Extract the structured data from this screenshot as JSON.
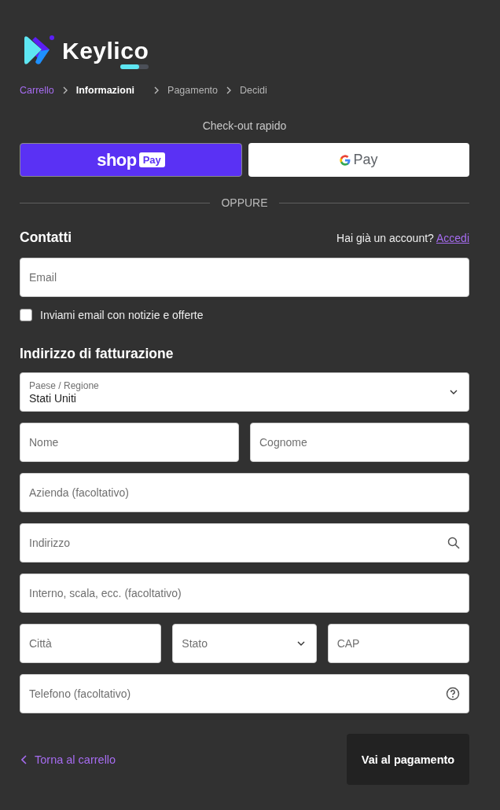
{
  "brand": {
    "name": "Keylico"
  },
  "breadcrumb": [
    {
      "label": "Carrello",
      "done": true,
      "selected": false
    },
    {
      "label": "Informazioni",
      "done": false,
      "selected": true
    },
    {
      "label": "Pagamento",
      "done": false,
      "selected": false
    },
    {
      "label": "Decidi",
      "done": false,
      "selected": false
    }
  ],
  "express": {
    "title": "Check-out rapido",
    "shop_pay": {
      "word": "shop",
      "badge": "Pay"
    },
    "google_pay": {
      "word": "Pay"
    }
  },
  "divider": "OPPURE",
  "contact": {
    "heading": "Contatti",
    "account_prompt": "Hai già un account?",
    "login_link": "Accedi",
    "email_placeholder": "Email",
    "newsletter": {
      "label": "Inviami email con notizie e offerte",
      "checked": false
    }
  },
  "billing": {
    "heading": "Indirizzo di fatturazione",
    "rows": [
      [
        {
          "kind": "select",
          "label": "Paese / Regione",
          "value": "Stati Uniti"
        }
      ],
      [
        {
          "kind": "text",
          "placeholder": "Nome"
        },
        {
          "kind": "text",
          "placeholder": "Cognome"
        }
      ],
      [
        {
          "kind": "text",
          "placeholder": "Azienda (facoltativo)"
        }
      ],
      [
        {
          "kind": "search",
          "placeholder": "Indirizzo"
        }
      ],
      [
        {
          "kind": "text",
          "placeholder": "Interno, scala, ecc. (facoltativo)"
        }
      ],
      [
        {
          "kind": "text",
          "placeholder": "Città"
        },
        {
          "kind": "select",
          "placeholder": "Stato"
        },
        {
          "kind": "text",
          "placeholder": "CAP"
        }
      ],
      [
        {
          "kind": "help",
          "placeholder": "Telefono (facoltativo)"
        }
      ]
    ]
  },
  "footer": {
    "back_link": "Torna al carrello",
    "continue_button": "Vai al pagamento"
  }
}
